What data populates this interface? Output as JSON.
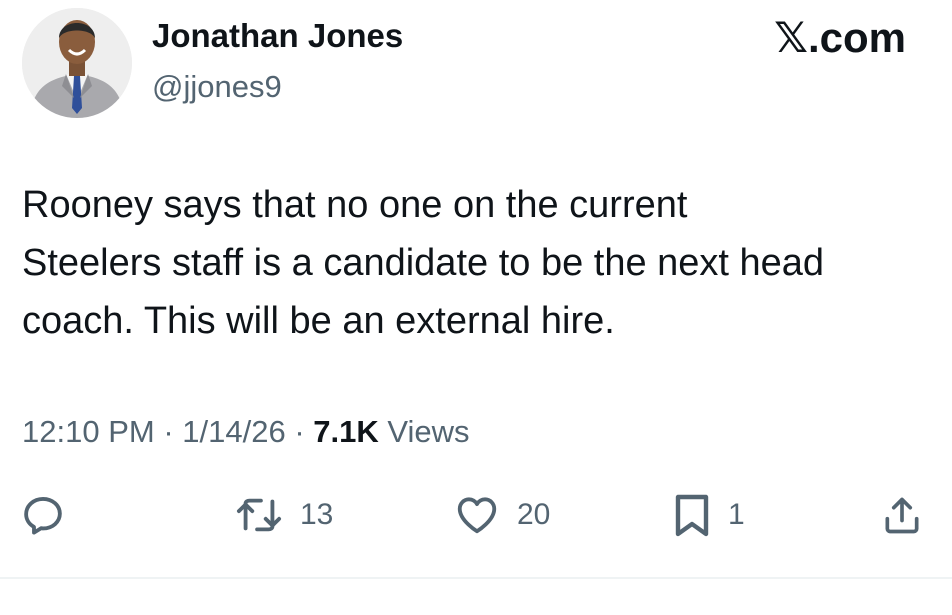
{
  "author": {
    "display_name": "Jonathan Jones",
    "handle": "@jjones9",
    "avatar_icon": "profile-photo"
  },
  "brand": {
    "label": "𝕏.com"
  },
  "tweet": {
    "text": "Rooney says that no one on the current\nSteelers staff is a candidate to be the next head\ncoach. This will be an external hire."
  },
  "meta": {
    "time": "12:10 PM",
    "separator": " · ",
    "date": "1/14/26",
    "views_count": "7.1K",
    "views_label": " Views"
  },
  "actions": {
    "reply": {
      "icon": "reply-icon"
    },
    "repost": {
      "icon": "repost-icon",
      "count": "13"
    },
    "like": {
      "icon": "heart-icon",
      "count": "20"
    },
    "bookmark": {
      "icon": "bookmark-icon",
      "count": "1"
    },
    "share": {
      "icon": "share-icon"
    }
  },
  "colors": {
    "text_primary": "#0f1419",
    "text_secondary": "#536471",
    "divider": "#eff3f4",
    "background": "#ffffff"
  }
}
